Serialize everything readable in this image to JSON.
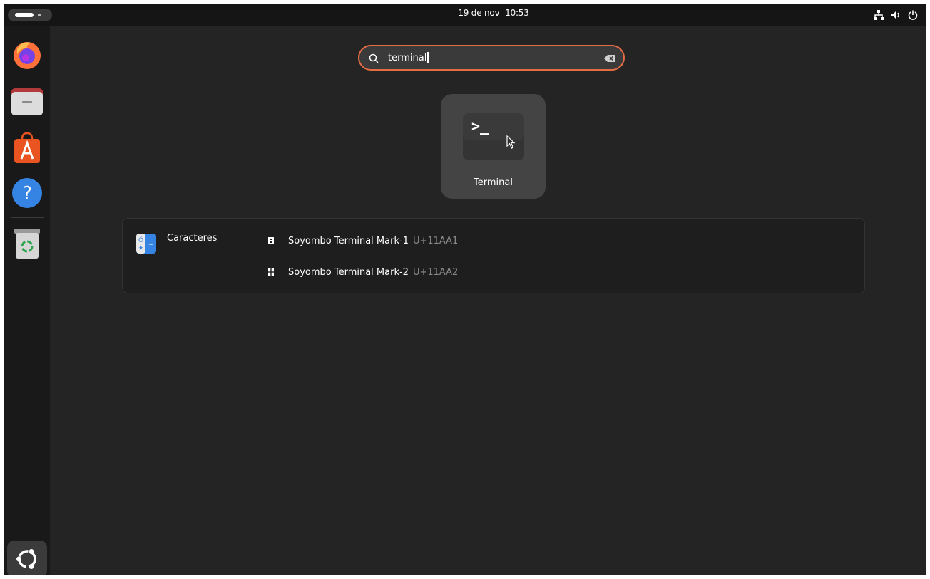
{
  "topbar": {
    "date": "19 de nov",
    "time": "10:53",
    "tray_icons": [
      "network-icon",
      "volume-icon",
      "power-icon"
    ]
  },
  "dock": {
    "apps": [
      {
        "name": "firefox-icon",
        "color": "#ff7139"
      },
      {
        "name": "files-icon",
        "color": "#e9e9e9"
      },
      {
        "name": "app-center-icon",
        "color": "#e95420"
      },
      {
        "name": "help-icon",
        "color": "#3584e4"
      },
      {
        "name": "trash-icon",
        "color": "#cfcfcf"
      }
    ],
    "show_apps_icon": "ubuntu-logo-icon"
  },
  "search": {
    "value": "terminal",
    "icon": "search-icon",
    "clear_icon": "clear-text-icon",
    "border_color": "#e66d43"
  },
  "app_results": [
    {
      "label": "Terminal",
      "icon": "terminal-icon",
      "prompt": ">_"
    }
  ],
  "provider": {
    "name": "Caracteres",
    "icon": "characters-app-icon",
    "results": [
      {
        "name": "Soyombo Terminal Mark-1",
        "code": "U+11AA1"
      },
      {
        "name": "Soyombo Terminal Mark-2",
        "code": "U+11AA2"
      }
    ]
  }
}
